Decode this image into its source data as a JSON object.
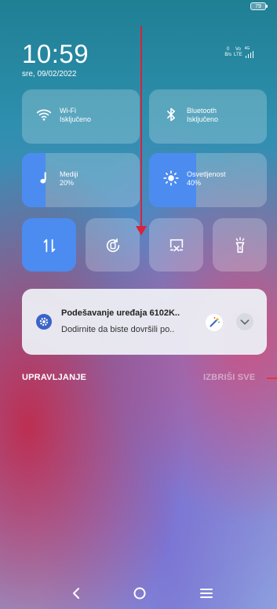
{
  "status_bar": {
    "battery": "79",
    "net_speed": "0",
    "net_unit": "B/s",
    "volte": "Vo",
    "lte": "LTE",
    "signal": "4G"
  },
  "header": {
    "time": "10:59",
    "date": "sre, 09/02/2022"
  },
  "tiles": {
    "wifi": {
      "title": "Wi-Fi",
      "status": "Isključeno"
    },
    "bluetooth": {
      "title": "Bluetooth",
      "status": "Isključeno"
    },
    "media": {
      "title": "Mediji",
      "value": "20%",
      "level": 0.2
    },
    "brightness": {
      "title": "Osvetljenost",
      "value": "40%",
      "level": 0.4
    }
  },
  "toggles": [
    {
      "icon": "mobile-data-icon",
      "active": true
    },
    {
      "icon": "auto-rotate-icon",
      "active": false
    },
    {
      "icon": "screenshot-icon",
      "active": false
    },
    {
      "icon": "flashlight-icon",
      "active": false
    }
  ],
  "notification": {
    "title": "Podešavanje uređaja 6102K..",
    "text": "Dodirnite da biste dovršili po..",
    "icon": "settings-gear-icon"
  },
  "actions": {
    "manage": "UPRAVLJANJE",
    "clear_all": "IZBRIŠI SVE"
  },
  "colors": {
    "accent": "#4c8cf0",
    "annotation_arrow": "#d8233a"
  }
}
